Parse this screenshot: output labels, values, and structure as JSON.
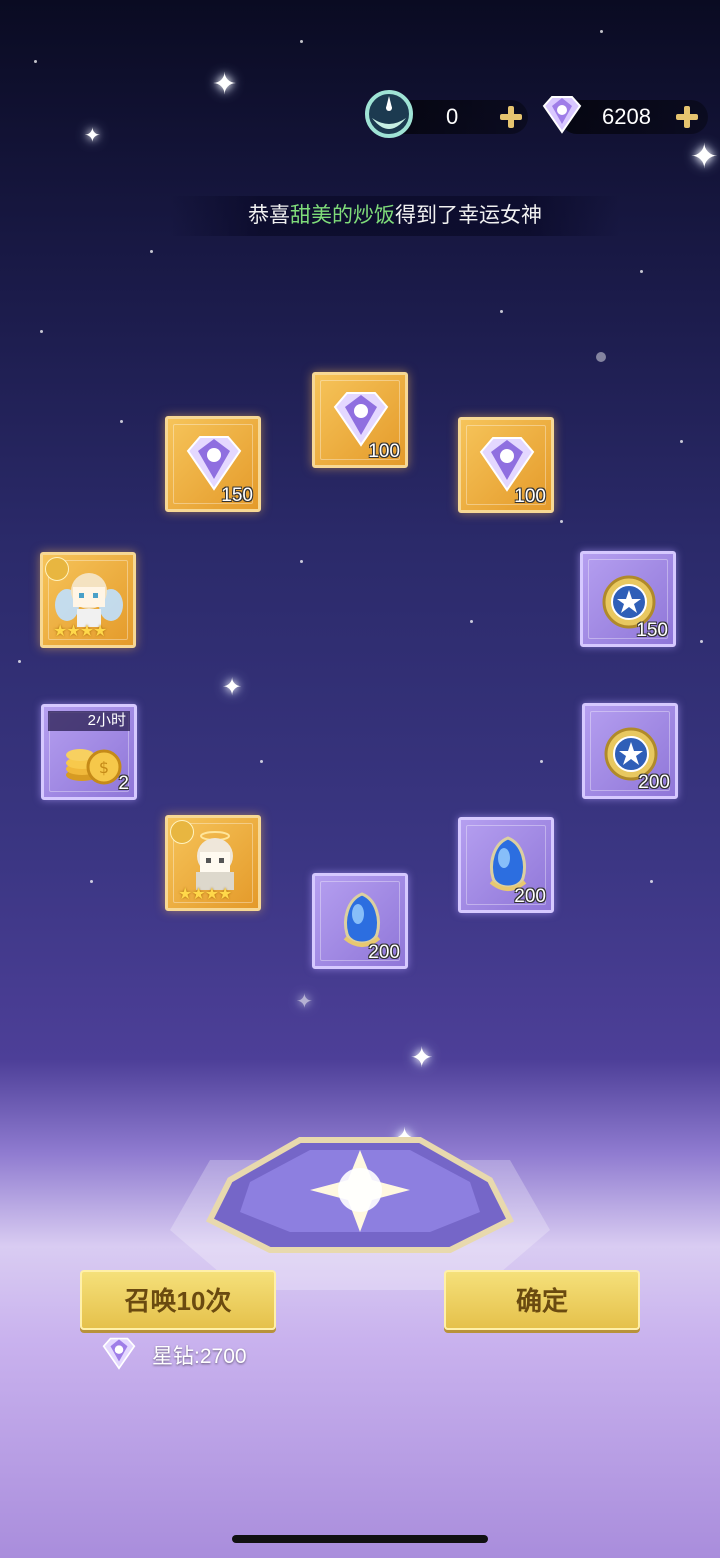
{
  "currency": {
    "moon_value": "0",
    "gem_value": "6208"
  },
  "announcement": {
    "prefix": "恭喜",
    "player_name": "甜美的炒饭",
    "suffix": "得到了幸运女神"
  },
  "rewards": [
    {
      "type": "diamond",
      "frame": "gold",
      "qty": "150"
    },
    {
      "type": "diamond",
      "frame": "gold",
      "qty": "100"
    },
    {
      "type": "diamond",
      "frame": "gold",
      "qty": "100"
    },
    {
      "type": "hero-angel",
      "frame": "gold",
      "stars": "★★★★"
    },
    {
      "type": "star-coin",
      "frame": "purple",
      "qty": "150"
    },
    {
      "type": "gold-coins",
      "frame": "purple",
      "qty": "2",
      "timer": "2小时"
    },
    {
      "type": "star-coin",
      "frame": "purple",
      "qty": "200"
    },
    {
      "type": "hero-priestess",
      "frame": "gold",
      "stars": "★★★★"
    },
    {
      "type": "blue-crystal",
      "frame": "purple",
      "qty": "200"
    },
    {
      "type": "blue-crystal",
      "frame": "purple",
      "qty": "200"
    }
  ],
  "buttons": {
    "summon_label": "召唤10次",
    "confirm_label": "确定"
  },
  "cost": {
    "label": "星钻:2700"
  },
  "colors": {
    "highlight_name": "#7fdc7a",
    "button_gold": "#e5c14b",
    "card_gold": "#f6c45a",
    "card_purple": "#8f76d8"
  }
}
